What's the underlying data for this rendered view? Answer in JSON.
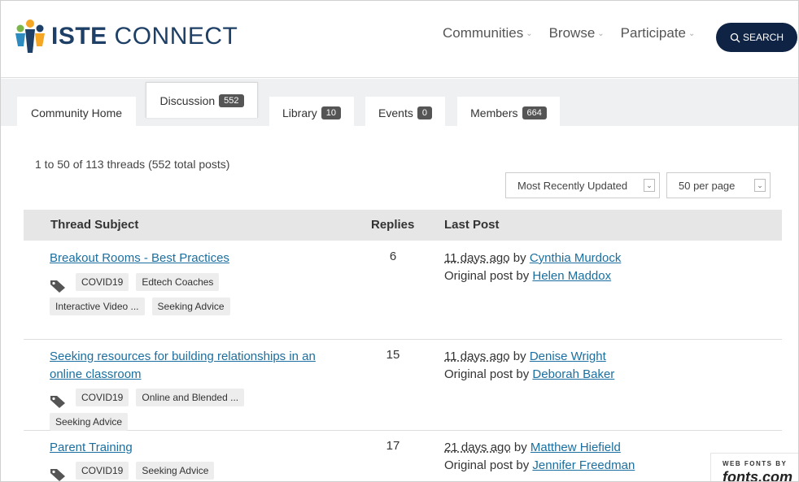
{
  "header": {
    "logo_bold": "ISTE",
    "logo_light": " CONNECT",
    "nav": [
      {
        "label": "Communities"
      },
      {
        "label": "Browse"
      },
      {
        "label": "Participate"
      }
    ],
    "search_label": "SEARCH",
    "brand_color": "#1e3f66",
    "search_bg": "#0f2344"
  },
  "tabs": {
    "home": {
      "label": "Community Home"
    },
    "discussion": {
      "label": "Discussion",
      "count": "552"
    },
    "library": {
      "label": "Library",
      "count": "10"
    },
    "events": {
      "label": "Events",
      "count": "0"
    },
    "members": {
      "label": "Members",
      "count": "664"
    }
  },
  "summary": "1 to 50 of 113 threads (552 total posts)",
  "controls": {
    "sort_value": "Most Recently Updated",
    "per_page_value": "50 per page"
  },
  "table": {
    "headers": {
      "subject": "Thread Subject",
      "replies": "Replies",
      "last_post": "Last Post"
    },
    "rows": [
      {
        "subject": "Breakout Rooms - Best Practices",
        "replies": "6",
        "when": "11 days ago",
        "by_label": " by ",
        "last_user": "Cynthia Murdock",
        "orig_label": "Original post by ",
        "orig_user": "Helen Maddox",
        "tags": [
          "COVID19",
          "Edtech Coaches",
          "Interactive Video ...",
          "Seeking Advice"
        ]
      },
      {
        "subject": "Seeking resources for building relationships in an online classroom",
        "replies": "15",
        "when": "11 days ago",
        "by_label": " by ",
        "last_user": "Denise Wright",
        "orig_label": "Original post by ",
        "orig_user": "Deborah Baker",
        "tags": [
          "COVID19",
          "Online and Blended ...",
          "Seeking Advice"
        ]
      },
      {
        "subject": "Parent Training",
        "replies": "17",
        "when": "21 days ago",
        "by_label": " by ",
        "last_user": "Matthew Hiefield",
        "orig_label": "Original post by ",
        "orig_user": "Jennifer Freedman",
        "tags": [
          "COVID19",
          "Seeking Advice"
        ]
      }
    ]
  },
  "badge": {
    "small": "WEB FONTS BY",
    "big": "fonts.com"
  },
  "colors": {
    "link": "#1a6fa0",
    "band": "#eef0f2",
    "table_header": "#e6e6e6"
  }
}
